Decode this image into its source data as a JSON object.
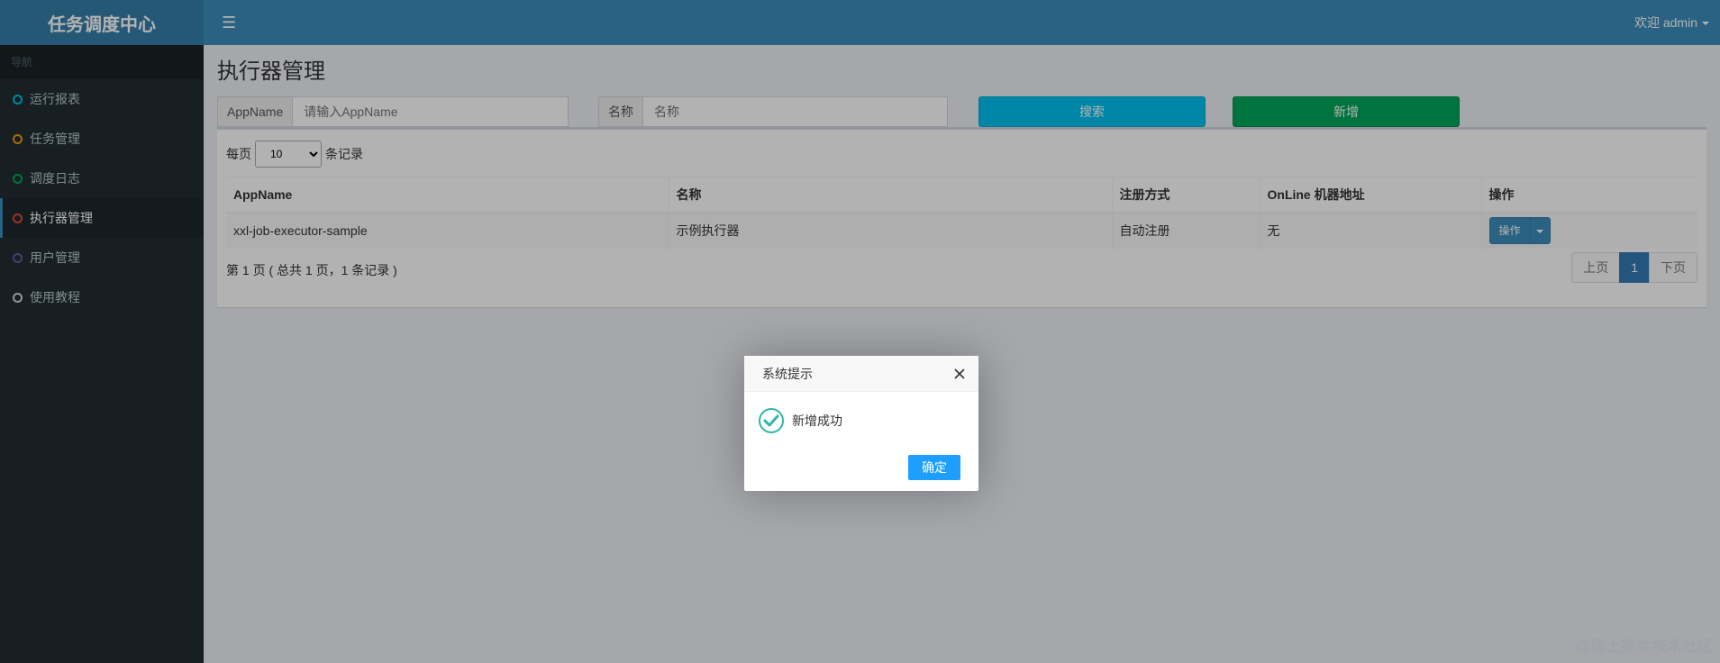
{
  "app": {
    "title": "任务调度中心"
  },
  "header": {
    "menu_icon": "hamburger-icon",
    "user_label": "欢迎 admin"
  },
  "sidebar": {
    "header": "导航",
    "items": [
      {
        "label": "运行报表",
        "color": "#00c0ef"
      },
      {
        "label": "任务管理",
        "color": "#f39c12"
      },
      {
        "label": "调度日志",
        "color": "#00a65a"
      },
      {
        "label": "执行器管理",
        "color": "#dd4b39"
      },
      {
        "label": "用户管理",
        "color": "#605ca8"
      },
      {
        "label": "使用教程",
        "color": "#d2d6de"
      }
    ],
    "active_index": 3
  },
  "main": {
    "title": "执行器管理",
    "search": {
      "appname_label": "AppName",
      "appname_placeholder": "请输入AppName",
      "name_label": "名称",
      "name_placeholder": "名称",
      "search_button": "搜索",
      "add_button": "新增"
    },
    "length": {
      "prefix": "每页",
      "value": "10",
      "suffix": "条记录"
    },
    "table": {
      "columns": [
        "AppName",
        "名称",
        "注册方式",
        "OnLine 机器地址",
        "操作"
      ],
      "rows": [
        {
          "appname": "xxl-job-executor-sample",
          "name": "示例执行器",
          "reg_type": "自动注册",
          "address": "无",
          "op": "操作"
        }
      ]
    },
    "info": "第 1 页 ( 总共 1 页，1 条记录 )",
    "pager": {
      "prev": "上页",
      "current": "1",
      "next": "下页"
    }
  },
  "dialog": {
    "title": "系统提示",
    "message": "新增成功",
    "ok": "确定",
    "icon": "success-check-icon",
    "accent": "#1e9fff"
  },
  "watermark": "@稀土掘金技术社区"
}
